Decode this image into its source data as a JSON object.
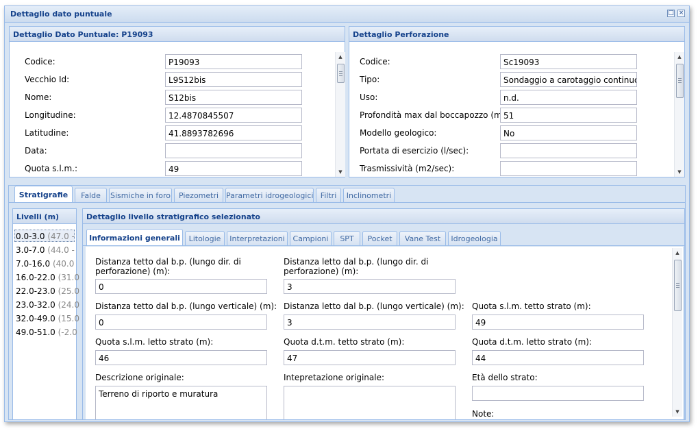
{
  "window": {
    "title": "Dettaglio dato puntuale"
  },
  "tools": {
    "restore": "□",
    "close": "×"
  },
  "dato_panel": {
    "title": "Dettaglio Dato Puntuale: P19093",
    "fields": [
      {
        "label": "Codice:",
        "value": "P19093"
      },
      {
        "label": "Vecchio Id:",
        "value": "L9S12bis"
      },
      {
        "label": "Nome:",
        "value": "S12bis"
      },
      {
        "label": "Longitudine:",
        "value": "12.4870845507"
      },
      {
        "label": "Latitudine:",
        "value": "41.8893782696"
      },
      {
        "label": "Data:",
        "value": ""
      },
      {
        "label": "Quota s.l.m.:",
        "value": "49"
      }
    ]
  },
  "perf_panel": {
    "title": "Dettaglio Perforazione",
    "fields": [
      {
        "label": "Codice:",
        "value": "Sc19093"
      },
      {
        "label": "Tipo:",
        "value": "Sondaggio a carotaggio continuo"
      },
      {
        "label": "Uso:",
        "value": "n.d."
      },
      {
        "label": "Profondità max dal boccapozzo (m):",
        "value": "51"
      },
      {
        "label": "Modello geologico:",
        "value": "No"
      },
      {
        "label": "Portata di esercizio (l/sec):",
        "value": ""
      },
      {
        "label": "Trasmissività (m2/sec):",
        "value": ""
      }
    ]
  },
  "main_tabs": [
    "Stratigrafie",
    "Falde",
    "Sismiche in foro",
    "Piezometri",
    "Parametri idrogeologici",
    "Filtri",
    "Inclinometri"
  ],
  "levels": {
    "title": "Livelli (m)",
    "items": [
      {
        "range": "0.0-3.0",
        "extra": "(47.0 -"
      },
      {
        "range": "3.0-7.0",
        "extra": "(44.0 -"
      },
      {
        "range": "7.0-16.0",
        "extra": "(40.0"
      },
      {
        "range": "16.0-22.0",
        "extra": "(31.0"
      },
      {
        "range": "22.0-23.0",
        "extra": "(25.0"
      },
      {
        "range": "23.0-32.0",
        "extra": "(24.0"
      },
      {
        "range": "32.0-49.0",
        "extra": "(15.0"
      },
      {
        "range": "49.0-51.0",
        "extra": "(-2.0"
      }
    ]
  },
  "detail": {
    "title": "Dettaglio livello stratigrafico selezionato",
    "tabs": [
      "Informazioni generali",
      "Litologie",
      "Interpretazioni",
      "Campioni",
      "SPT",
      "Pocket",
      "Vane Test",
      "Idrogeologia"
    ],
    "fields": {
      "dist_tetto_dir": {
        "label": "Distanza tetto dal b.p. (lungo dir. di perforazione) (m):",
        "value": "0"
      },
      "dist_letto_dir": {
        "label": "Distanza letto dal b.p. (lungo dir. di perforazione) (m):",
        "value": "3"
      },
      "dist_tetto_vert": {
        "label": "Distanza tetto dal b.p. (lungo verticale) (m):",
        "value": "0"
      },
      "dist_letto_vert": {
        "label": "Distanza letto dal b.p. (lungo verticale) (m):",
        "value": "3"
      },
      "quota_slm_tetto": {
        "label": "Quota s.l.m. tetto strato (m):",
        "value": "49"
      },
      "quota_slm_letto": {
        "label": "Quota s.l.m. letto strato (m):",
        "value": "46"
      },
      "quota_dtm_tetto": {
        "label": "Quota d.t.m. tetto strato (m):",
        "value": "47"
      },
      "quota_dtm_letto": {
        "label": "Quota d.t.m. letto strato (m):",
        "value": "44"
      },
      "descrizione": {
        "label": "Descrizione originale:",
        "value": "Terreno di riporto e muratura"
      },
      "interpretazione": {
        "label": "Intepretazione originale:",
        "value": ""
      },
      "eta": {
        "label": "Età dello strato:",
        "value": ""
      },
      "note": {
        "label": "Note:"
      }
    }
  }
}
